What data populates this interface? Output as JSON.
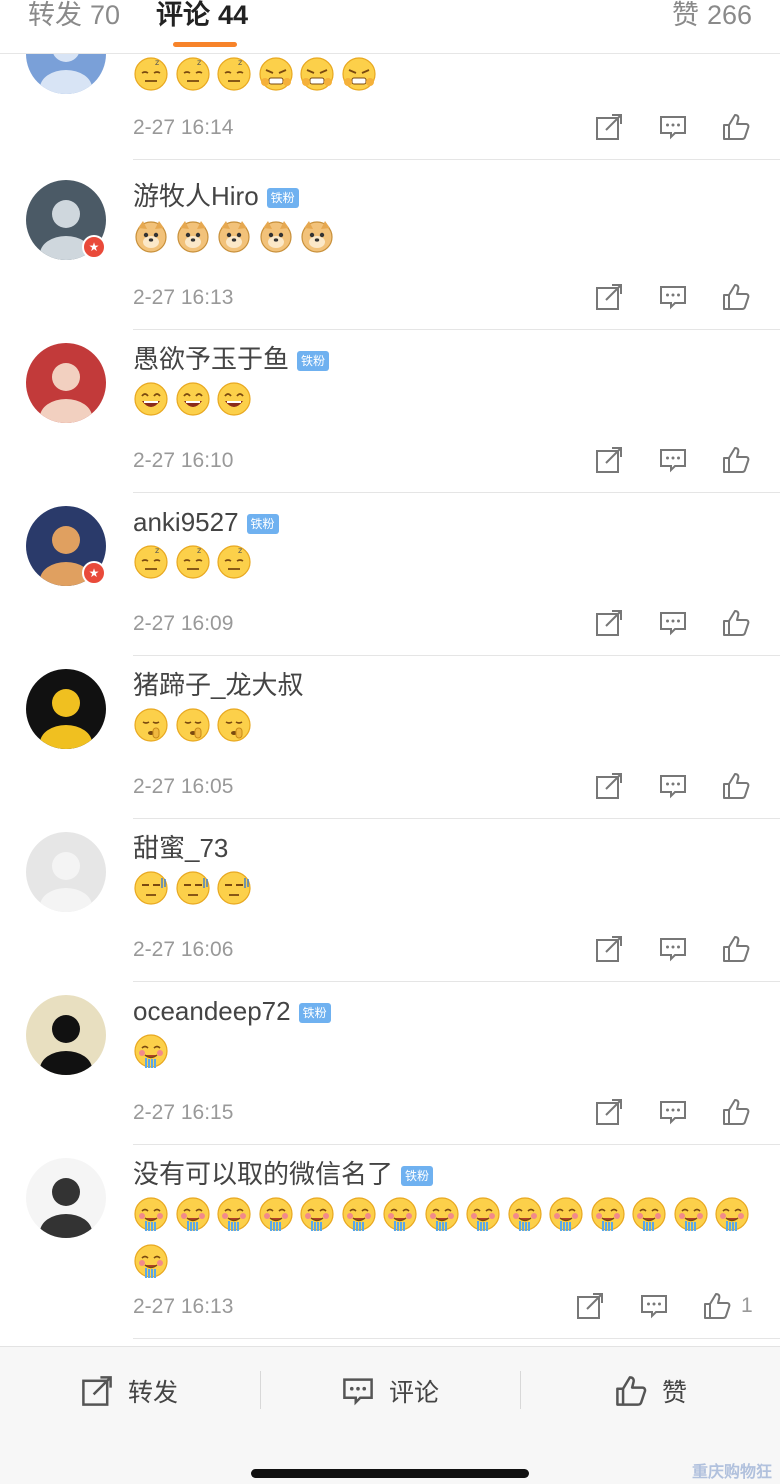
{
  "tabs": {
    "repost_label": "转发",
    "repost_count": "70",
    "comment_label": "评论",
    "comment_count": "44",
    "like_label": "赞",
    "like_count": "266"
  },
  "colors": {
    "accent": "#f7832a",
    "fan_badge": "#6fb1f0",
    "verified_badge": "#e94a3a"
  },
  "fan_badge_label": "铁粉",
  "comments": [
    {
      "name": "",
      "fan_badge": false,
      "emojis": [
        "sleepy",
        "sleepy",
        "sleepy",
        "angry",
        "angry",
        "angry"
      ],
      "time": "2-27 16:14",
      "likes": ""
    },
    {
      "name": "游牧人Hiro",
      "fan_badge": true,
      "emojis": [
        "doge",
        "doge",
        "doge",
        "doge",
        "doge"
      ],
      "time": "2-27 16:13",
      "likes": ""
    },
    {
      "name": "愚欲予玉于鱼",
      "fan_badge": true,
      "emojis": [
        "laugh",
        "laugh",
        "laugh"
      ],
      "time": "2-27 16:10",
      "likes": ""
    },
    {
      "name": "anki9527",
      "fan_badge": true,
      "emojis": [
        "sleepy",
        "sleepy",
        "sleepy"
      ],
      "time": "2-27 16:09",
      "likes": ""
    },
    {
      "name": "猪蹄子_龙大叔",
      "fan_badge": false,
      "emojis": [
        "shush",
        "shush",
        "shush"
      ],
      "time": "2-27 16:05",
      "likes": ""
    },
    {
      "name": "甜蜜_73",
      "fan_badge": false,
      "emojis": [
        "awkward",
        "awkward",
        "awkward"
      ],
      "time": "2-27 16:06",
      "likes": ""
    },
    {
      "name": "oceandeep72",
      "fan_badge": true,
      "emojis": [
        "crave"
      ],
      "time": "2-27 16:15",
      "likes": ""
    },
    {
      "name": "没有可以取的微信名了",
      "fan_badge": true,
      "emojis": [
        "crave",
        "crave",
        "crave",
        "crave",
        "crave",
        "crave",
        "crave",
        "crave",
        "crave",
        "crave",
        "crave",
        "crave",
        "crave",
        "crave",
        "crave",
        "crave"
      ],
      "time": "2-27 16:13",
      "likes": "1"
    }
  ],
  "bottom_bar": {
    "repost_label": "转发",
    "comment_label": "评论",
    "like_label": "赞"
  },
  "watermark": "重庆购物狂"
}
